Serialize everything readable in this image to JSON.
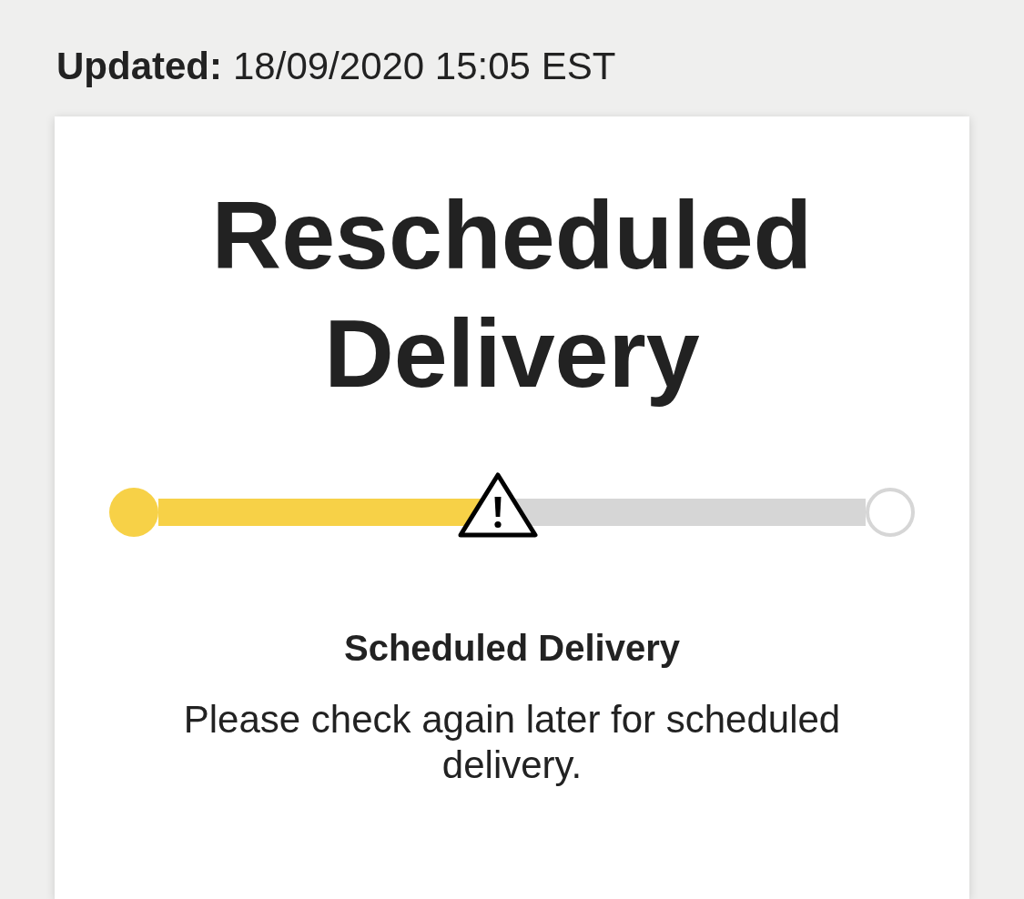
{
  "updated": {
    "label": "Updated:",
    "value": "18/09/2020 15:05 EST"
  },
  "card": {
    "title": "Rescheduled Delivery",
    "progress": {
      "level": 0.48,
      "marker": {
        "kind": "warning"
      }
    },
    "status": {
      "heading": "Scheduled Delivery",
      "message": "Please check again later for scheduled delivery."
    }
  }
}
